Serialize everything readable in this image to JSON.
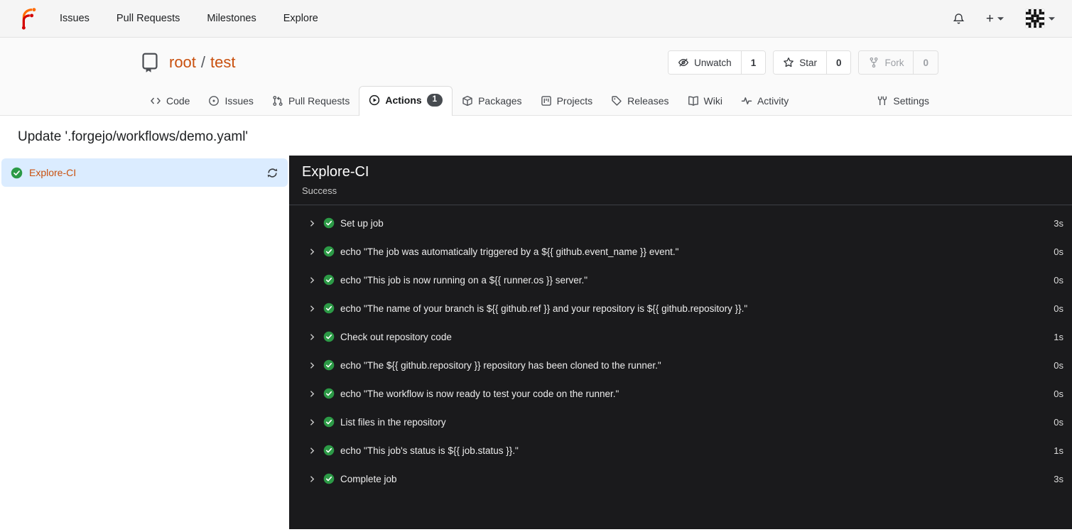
{
  "colors": {
    "accent_link": "#c9500e",
    "success_green": "#2c9a46",
    "selected_job_bg": "#dbecff",
    "panel_bg": "#1a1a1c",
    "badge_bg": "#474b50"
  },
  "navbar": {
    "logo_icon": "forgejo-logo",
    "items": [
      {
        "label": "Issues"
      },
      {
        "label": "Pull Requests"
      },
      {
        "label": "Milestones"
      },
      {
        "label": "Explore"
      }
    ],
    "right": {
      "bell_icon": "bell-icon",
      "plus_label": "+",
      "avatar_icon": "identicon-avatar"
    }
  },
  "repo_header": {
    "repo_icon": "repo-book-icon",
    "owner": "root",
    "separator": "/",
    "name": "test",
    "actions": [
      {
        "label": "Unwatch",
        "count": "1",
        "icon": "eye-off-icon",
        "disabled": false
      },
      {
        "label": "Star",
        "count": "0",
        "icon": "star-icon",
        "disabled": false
      },
      {
        "label": "Fork",
        "count": "0",
        "icon": "fork-icon",
        "disabled": true
      }
    ],
    "tabs": [
      {
        "label": "Code",
        "icon": "code-icon",
        "active": false
      },
      {
        "label": "Issues",
        "icon": "issue-icon",
        "active": false
      },
      {
        "label": "Pull Requests",
        "icon": "pull-request-icon",
        "active": false
      },
      {
        "label": "Actions",
        "icon": "play-circle-icon",
        "active": true,
        "badge": "1"
      },
      {
        "label": "Packages",
        "icon": "package-icon",
        "active": false
      },
      {
        "label": "Projects",
        "icon": "project-icon",
        "active": false
      },
      {
        "label": "Releases",
        "icon": "tag-icon",
        "active": false
      },
      {
        "label": "Wiki",
        "icon": "book-icon",
        "active": false
      },
      {
        "label": "Activity",
        "icon": "pulse-icon",
        "active": false
      },
      {
        "label": "Settings",
        "icon": "tools-icon",
        "active": false
      }
    ]
  },
  "page": {
    "title": "Update '.forgejo/workflows/demo.yaml'"
  },
  "jobs_sidebar": {
    "items": [
      {
        "label": "Explore-CI",
        "status": "success",
        "status_icon": "check-circle-icon",
        "action_icon": "refresh-icon"
      }
    ]
  },
  "job_panel": {
    "title": "Explore-CI",
    "status_text": "Success",
    "steps": [
      {
        "label": "Set up job",
        "duration": "3s"
      },
      {
        "label": "echo \"The job was automatically triggered by a ${{ github.event_name }} event.\"",
        "duration": "0s"
      },
      {
        "label": "echo \"This job is now running on a ${{ runner.os }} server.\"",
        "duration": "0s"
      },
      {
        "label": "echo \"The name of your branch is ${{ github.ref }} and your repository is ${{ github.repository }}.\"",
        "duration": "0s"
      },
      {
        "label": "Check out repository code",
        "duration": "1s"
      },
      {
        "label": "echo \"The ${{ github.repository }} repository has been cloned to the runner.\"",
        "duration": "0s"
      },
      {
        "label": "echo \"The workflow is now ready to test your code on the runner.\"",
        "duration": "0s"
      },
      {
        "label": "List files in the repository",
        "duration": "0s"
      },
      {
        "label": "echo \"This job's status is ${{ job.status }}.\"",
        "duration": "1s"
      },
      {
        "label": "Complete job",
        "duration": "3s"
      }
    ]
  }
}
